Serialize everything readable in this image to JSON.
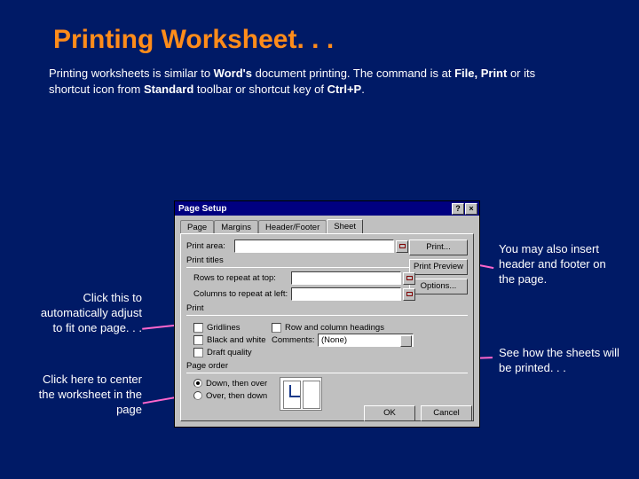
{
  "slide": {
    "title": "Printing Worksheet. . .",
    "body_pre": "Printing worksheets is similar to ",
    "body_b1": "Word's",
    "body_mid1": " document printing.  The command is at ",
    "body_b2": "File, Print",
    "body_mid2": " or its shortcut  icon from ",
    "body_b3": "Standard",
    "body_mid3": " toolbar or shortcut key of ",
    "body_b4": "Ctrl+P",
    "body_post": "."
  },
  "callouts": {
    "fit": "Click this to automatically adjust to fit one page. . .",
    "center": "Click here to center the worksheet in the page",
    "header": "You may also insert header and footer on the page.",
    "preview": "See how the sheets will be printed. . ."
  },
  "dialog": {
    "title": "Page Setup",
    "help": "?",
    "close": "×",
    "tabs": {
      "page": "Page",
      "margins": "Margins",
      "hf": "Header/Footer",
      "sheet": "Sheet"
    },
    "labels": {
      "print_area": "Print area:",
      "print_titles": "Print titles",
      "rows_top": "Rows to repeat at top:",
      "cols_left": "Columns to repeat at left:",
      "print": "Print",
      "gridlines": "Gridlines",
      "bw": "Black and white",
      "draft": "Draft quality",
      "rch": "Row and column headings",
      "comments": "Comments:",
      "page_order": "Page order",
      "down": "Down, then over",
      "over": "Over, then down"
    },
    "comments_value": "(None)",
    "buttons": {
      "print": "Print...",
      "preview": "Print Preview",
      "options": "Options...",
      "ok": "OK",
      "cancel": "Cancel"
    }
  }
}
